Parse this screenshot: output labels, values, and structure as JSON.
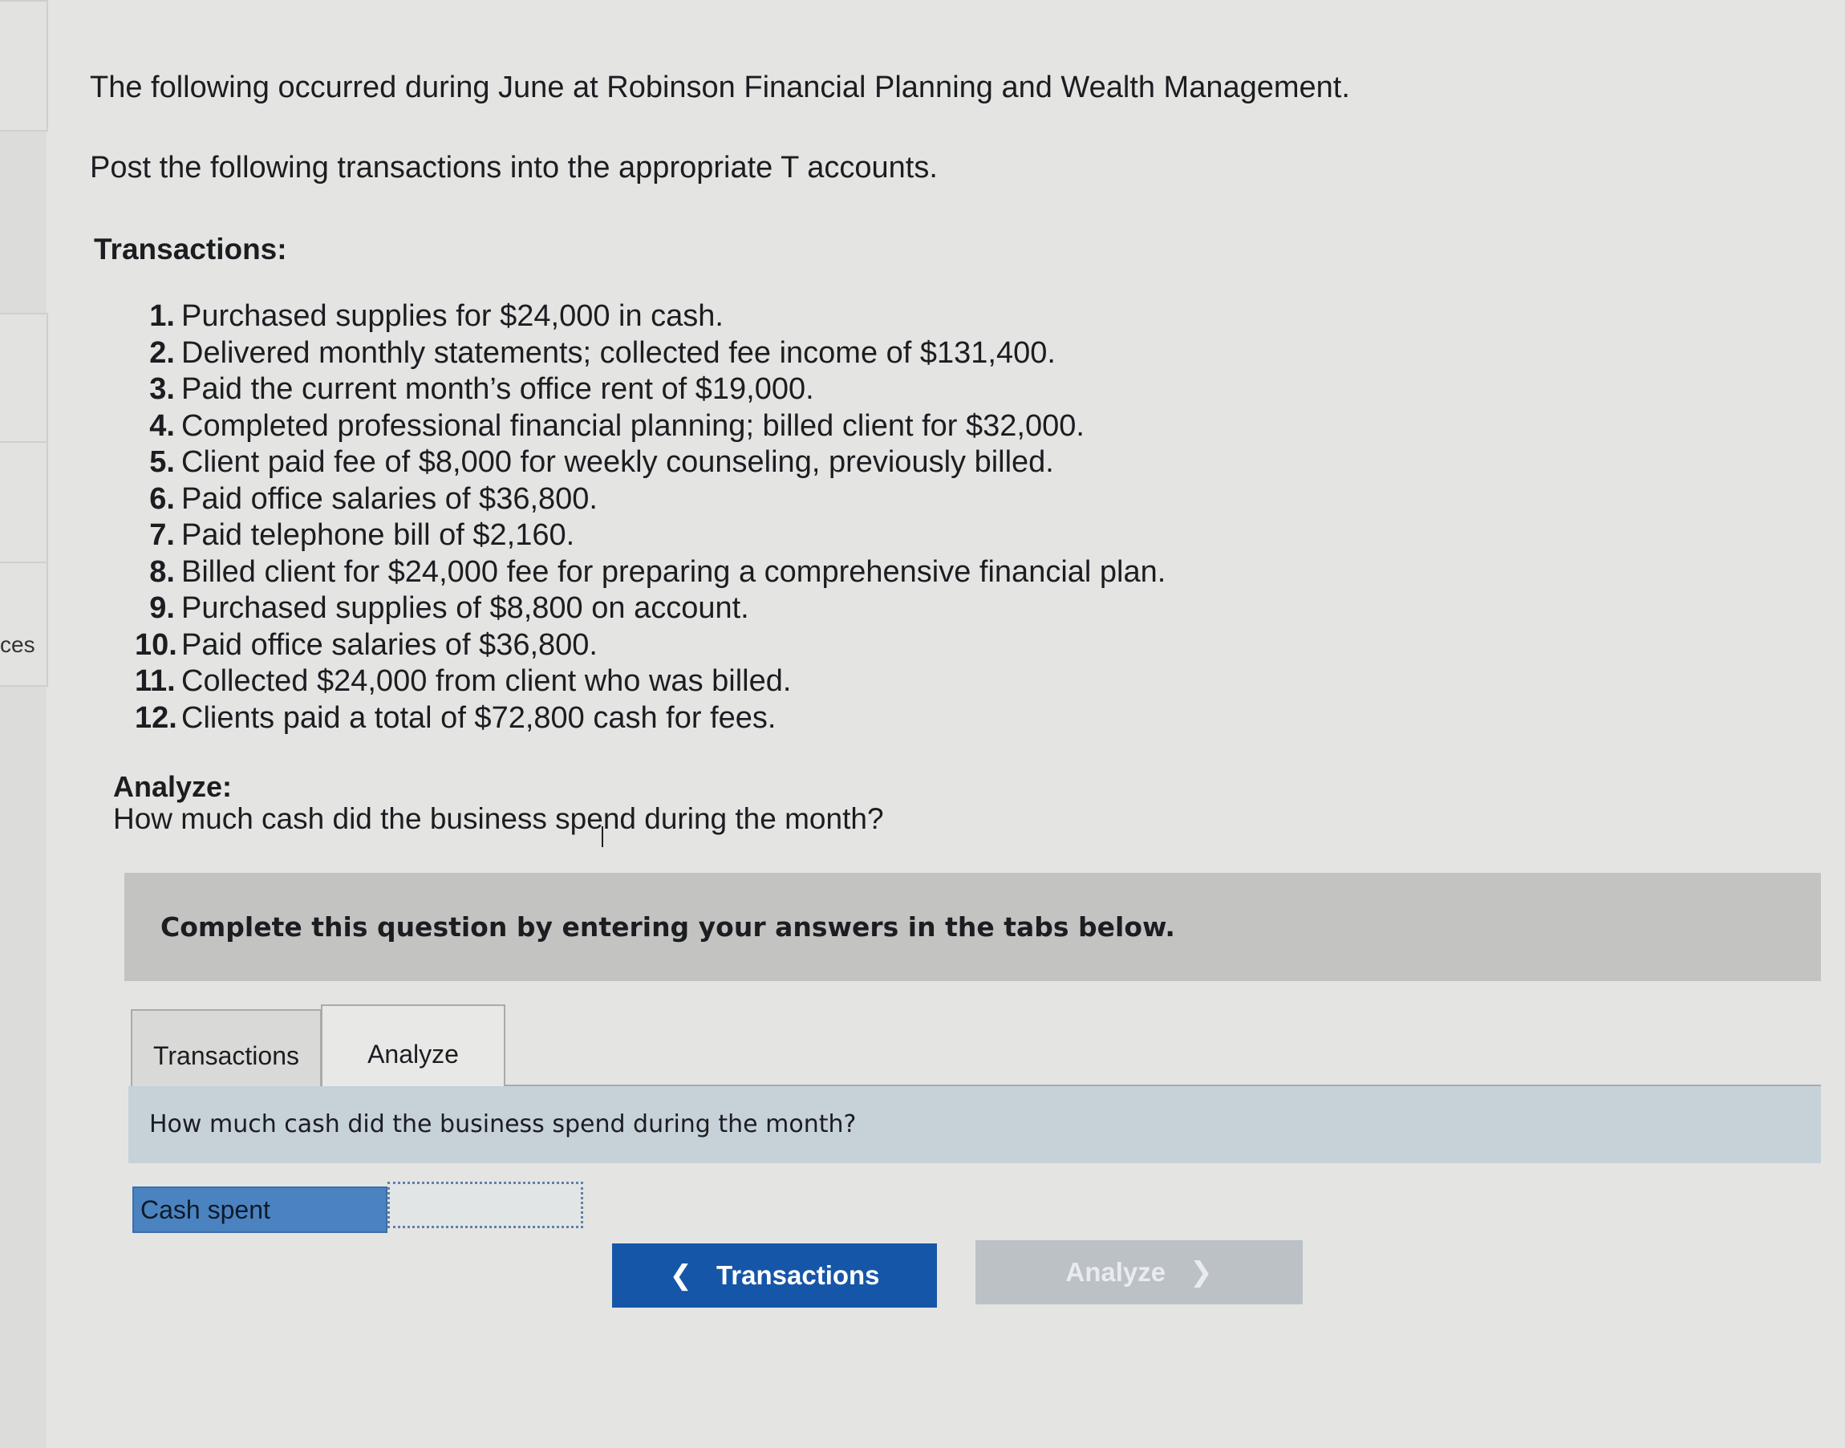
{
  "left_sidebar": {
    "fragment": "ces"
  },
  "intro": {
    "line1": "The following occurred during June at Robinson Financial Planning and Wealth Management.",
    "line2": "Post the following transactions into the appropriate T accounts."
  },
  "transactions": {
    "heading": "Transactions:",
    "items": [
      {
        "num": "1.",
        "text": "Purchased supplies for $24,000 in cash."
      },
      {
        "num": "2.",
        "text": "Delivered monthly statements; collected fee income of $131,400."
      },
      {
        "num": "3.",
        "text": "Paid the current month’s office rent of $19,000."
      },
      {
        "num": "4.",
        "text": "Completed professional financial planning; billed client for $32,000."
      },
      {
        "num": "5.",
        "text": "Client paid fee of $8,000 for weekly counseling, previously billed."
      },
      {
        "num": "6.",
        "text": "Paid office salaries of $36,800."
      },
      {
        "num": "7.",
        "text": "Paid telephone bill of $2,160."
      },
      {
        "num": "8.",
        "text": "Billed client for $24,000 fee for preparing a comprehensive financial plan."
      },
      {
        "num": "9.",
        "text": "Purchased supplies of $8,800 on account."
      },
      {
        "num": "10.",
        "text": "Paid office salaries of $36,800."
      },
      {
        "num": "11.",
        "text": "Collected $24,000 from client who was billed."
      },
      {
        "num": "12.",
        "text": "Clients paid a total of $72,800 cash for fees."
      }
    ]
  },
  "analyze": {
    "heading": "Analyze:",
    "question": "How much cash did the business spend during the month?"
  },
  "banner": {
    "text": "Complete this question by entering your answers in the tabs below."
  },
  "tabs": [
    {
      "label": "Transactions"
    },
    {
      "label": "Analyze"
    }
  ],
  "question_bar": {
    "text": "How much cash did the business spend during the month?"
  },
  "answer": {
    "label": "Cash spent",
    "value": ""
  },
  "nav": {
    "prev_label": "Transactions",
    "next_label": "Analyze"
  },
  "colors": {
    "banner": "#c3c4c1",
    "question_bar": "#c6d1d8",
    "answer_label": "#4b83c0",
    "prev_button": "#1656a8",
    "next_button_disabled": "#bcc1c6"
  },
  "icons": {
    "prev": "chevron-left-icon",
    "next": "chevron-right-icon"
  }
}
